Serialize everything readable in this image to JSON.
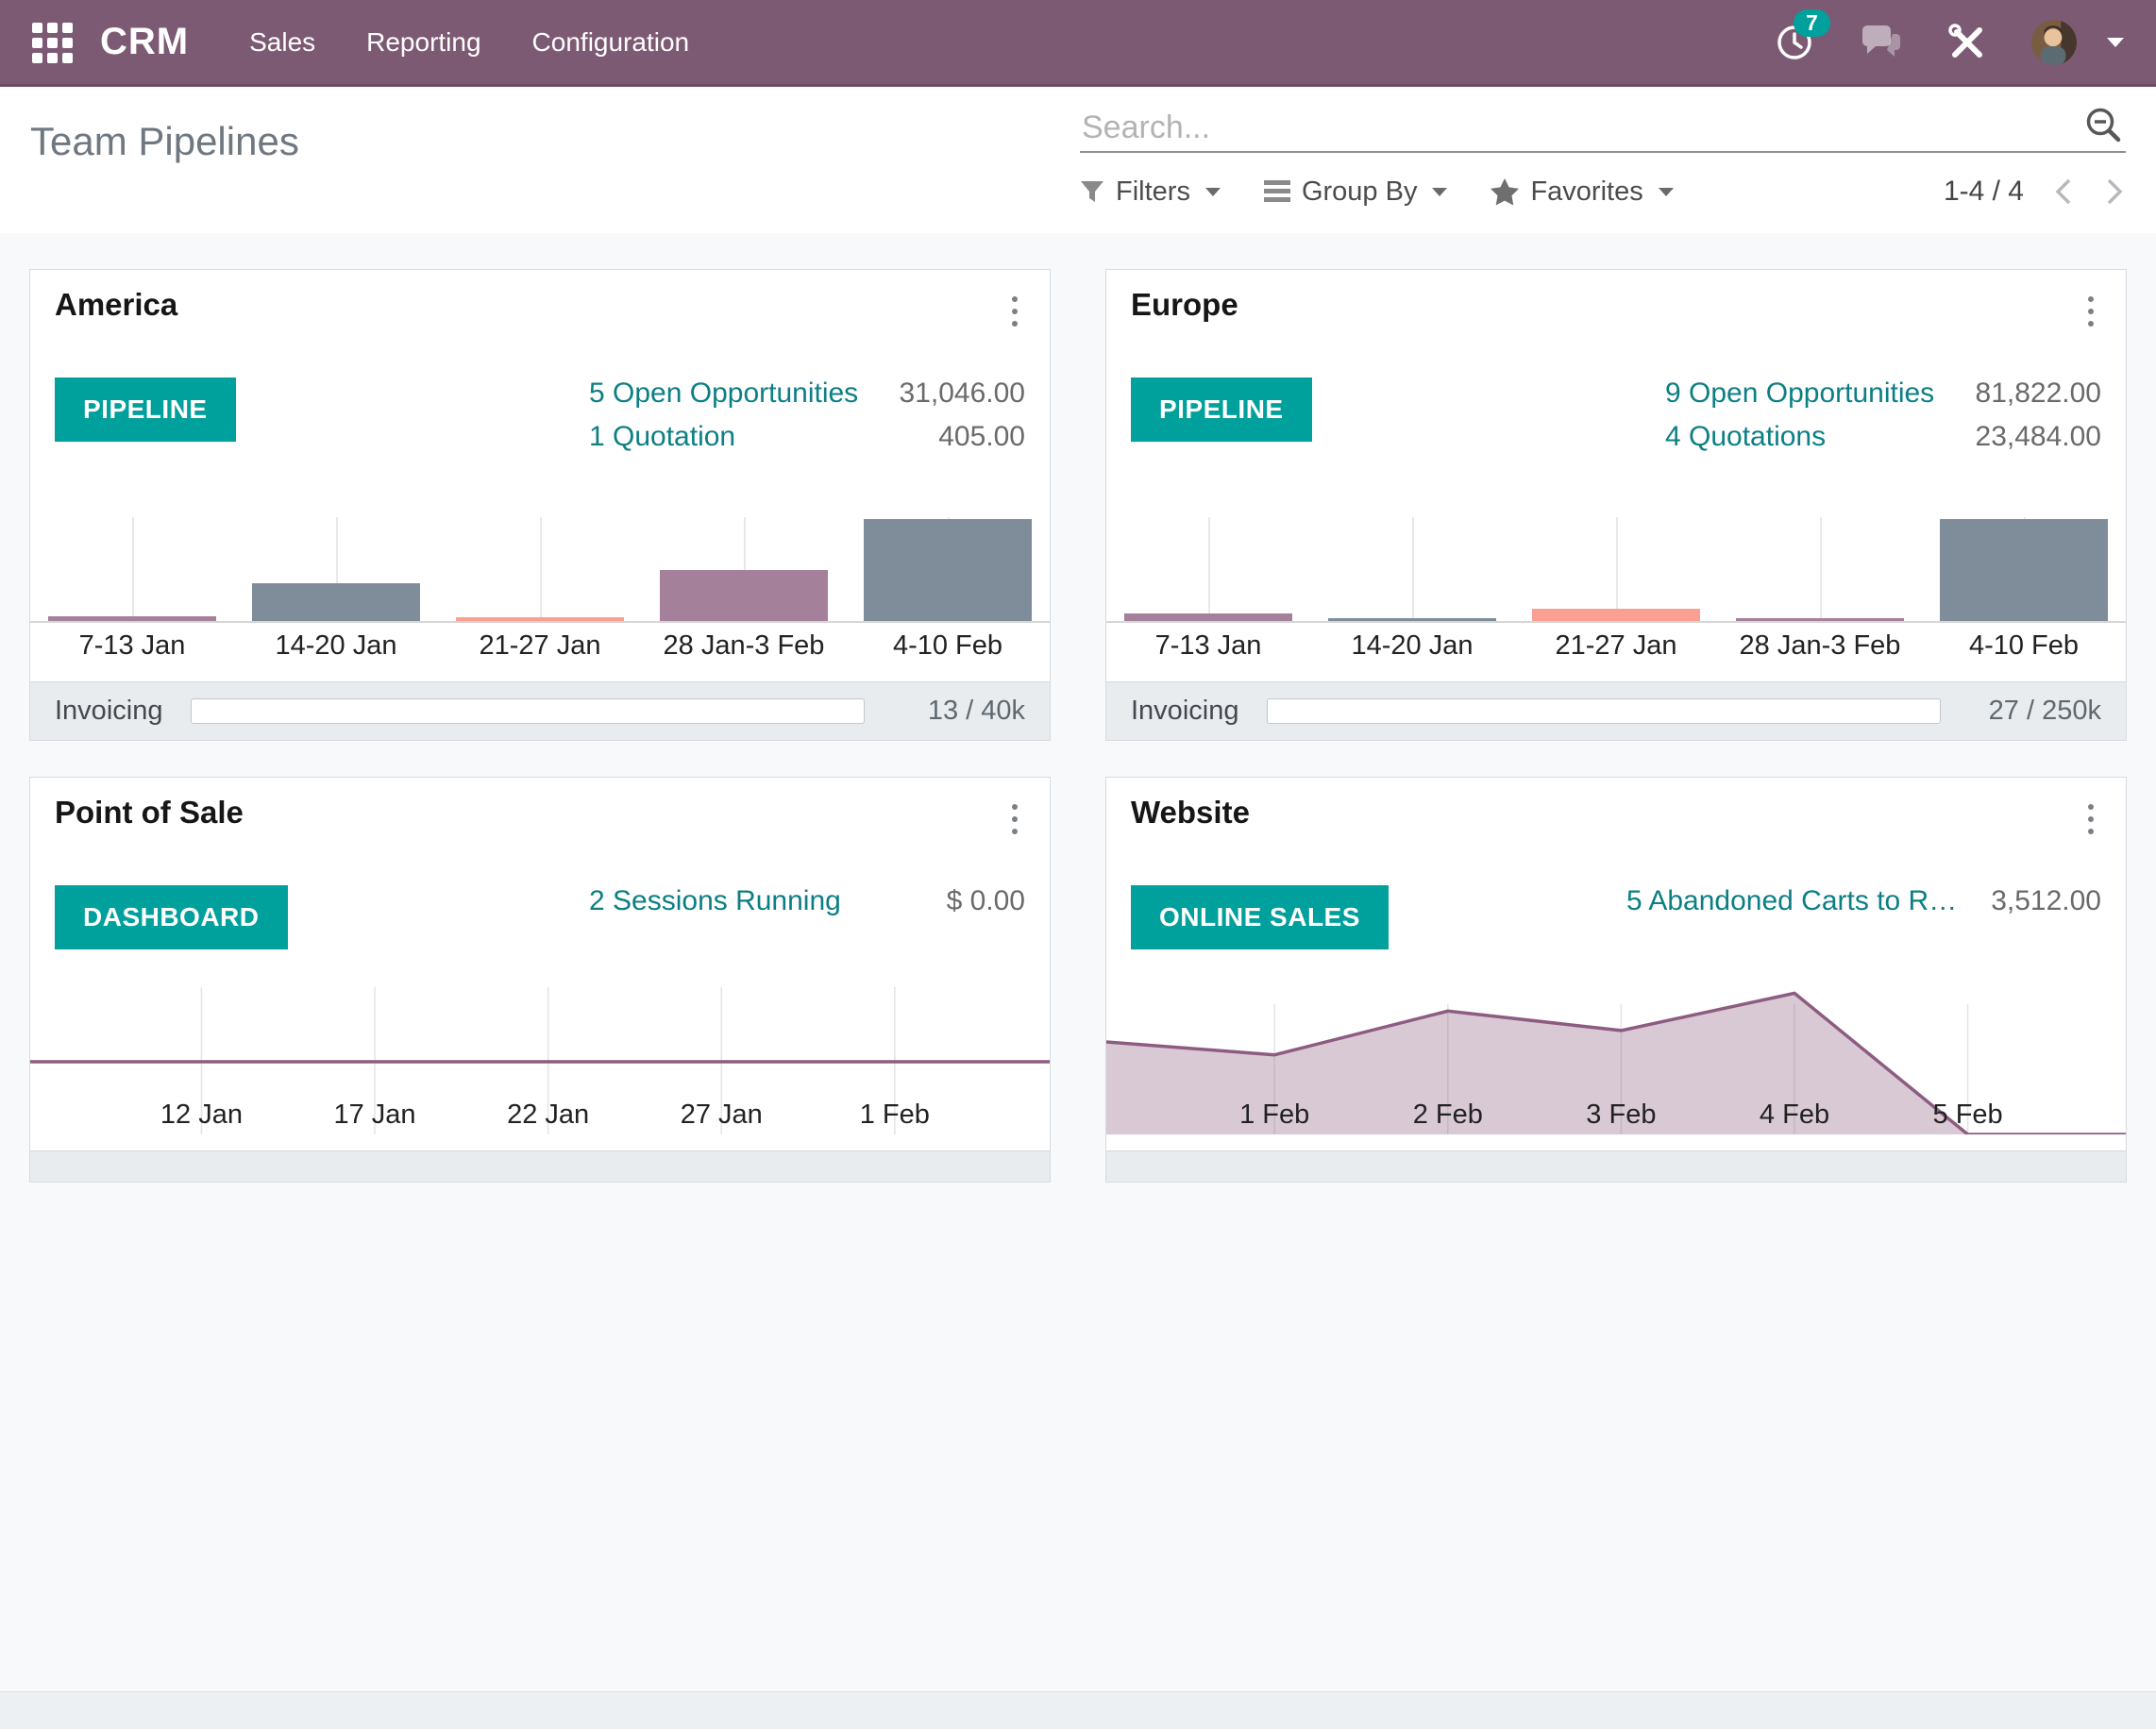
{
  "nav": {
    "app_label": "CRM",
    "menu_items": [
      "Sales",
      "Reporting",
      "Configuration"
    ],
    "activity_badge": "7"
  },
  "control_panel": {
    "title": "Team Pipelines",
    "search": {
      "placeholder": "Search..."
    },
    "filters": "Filters",
    "group_by": "Group By",
    "favorites": "Favorites",
    "pager": "1-4 / 4"
  },
  "colors": {
    "nav_background": "#7d5a74",
    "accent_teal": "#00a09d",
    "link_teal": "#0c7f84",
    "bar_gray": "#7e8d99",
    "bar_mauve": "#a5809a",
    "bar_salmon": "#f9a093",
    "line_purple": "#8d5c80",
    "footer_band": "#e9ecef"
  },
  "cards": [
    {
      "title": "America",
      "action_button": "PIPELINE",
      "stats": [
        {
          "label": "5 Open Opportunities",
          "value": "31,046.00"
        },
        {
          "label": "1 Quotation",
          "value": "405.00"
        }
      ],
      "footer": {
        "label": "Invoicing",
        "value": "13 / 40k",
        "progress_pct": 0
      }
    },
    {
      "title": "Europe",
      "action_button": "PIPELINE",
      "stats": [
        {
          "label": "9 Open Opportunities",
          "value": "81,822.00"
        },
        {
          "label": "4 Quotations",
          "value": "23,484.00"
        }
      ],
      "footer": {
        "label": "Invoicing",
        "value": "27 / 250k",
        "progress_pct": 0
      }
    },
    {
      "title": "Point of Sale",
      "action_button": "DASHBOARD",
      "stats": [
        {
          "label": "2 Sessions Running",
          "value": "$ 0.00"
        }
      ]
    },
    {
      "title": "Website",
      "action_button": "ONLINE SALES",
      "stats": [
        {
          "label": "5 Abandoned Carts to R…",
          "value": "3,512.00"
        }
      ]
    }
  ],
  "chart_data": [
    {
      "type": "bar",
      "card_title": "America",
      "categories": [
        "7-13 Jan",
        "14-20 Jan",
        "21-27 Jan",
        "28 Jan-3 Feb",
        "4-10 Feb"
      ],
      "values_rel": [
        0.04,
        0.32,
        0.03,
        0.43,
        0.86
      ],
      "bar_colors": [
        "#a5809a",
        "#7e8d99",
        "#f9a093",
        "#a5809a",
        "#7e8d99"
      ],
      "ylim": [
        0,
        1
      ],
      "grid": true,
      "legend": "none"
    },
    {
      "type": "bar",
      "card_title": "Europe",
      "categories": [
        "7-13 Jan",
        "14-20 Jan",
        "21-27 Jan",
        "28 Jan-3 Feb",
        "4-10 Feb"
      ],
      "values_rel": [
        0.065,
        0.025,
        0.105,
        0.025,
        0.86
      ],
      "bar_colors": [
        "#a5809a",
        "#7e8d99",
        "#f9a093",
        "#a5809a",
        "#7e8d99"
      ],
      "ylim": [
        0,
        1
      ],
      "grid": true,
      "legend": "none"
    },
    {
      "type": "line",
      "card_title": "Point of Sale",
      "categories": [
        "12 Jan",
        "17 Jan",
        "22 Jan",
        "27 Jan",
        "1 Feb"
      ],
      "x_frac": [
        0.168,
        0.338,
        0.508,
        0.678,
        0.848
      ],
      "values_rel": [
        0,
        0,
        0,
        0,
        0
      ],
      "axis_rel_y": 0.552,
      "line_color": "#8d5c80",
      "grid": true,
      "legend": "none"
    },
    {
      "type": "area",
      "card_title": "Website",
      "categories": [
        "1 Feb",
        "2 Feb",
        "3 Feb",
        "4 Feb",
        "5 Feb"
      ],
      "x_frac": [
        0.165,
        0.335,
        0.505,
        0.675,
        0.845
      ],
      "points": [
        [
          0,
          0.57
        ],
        [
          0.165,
          0.49
        ],
        [
          0.335,
          0.76
        ],
        [
          0.505,
          0.64
        ],
        [
          0.675,
          0.87
        ],
        [
          0.845,
          0
        ],
        [
          1,
          0
        ]
      ],
      "line_color": "#8d5c80",
      "fill_color": "rgba(141,92,128,0.33)",
      "grid": true,
      "legend": "none"
    }
  ]
}
